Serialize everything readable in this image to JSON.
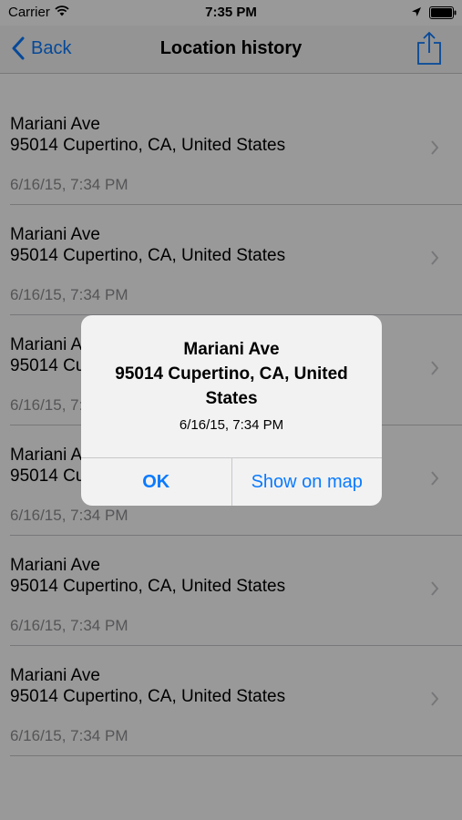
{
  "status_bar": {
    "carrier": "Carrier",
    "time": "7:35 PM",
    "icons": [
      "wifi-icon",
      "location-arrow-icon",
      "battery-icon"
    ]
  },
  "nav": {
    "back_label": "Back",
    "title": "Location history",
    "share_icon": "share-icon"
  },
  "history": [
    {
      "street": "Mariani Ave",
      "city": "95014 Cupertino, CA, United States",
      "date": "6/16/15, 7:34 PM"
    },
    {
      "street": "Mariani Ave",
      "city": "95014 Cupertino, CA, United States",
      "date": "6/16/15, 7:34 PM"
    },
    {
      "street": "Mariani Ave",
      "city": "95014 Cupertino, CA, United States",
      "date": "6/16/15, 7:34 PM"
    },
    {
      "street": "Mariani Ave",
      "city": "95014 Cupertino, CA, United States",
      "date": "6/16/15, 7:34 PM"
    },
    {
      "street": "Mariani Ave",
      "city": "95014 Cupertino, CA, United States",
      "date": "6/16/15, 7:34 PM"
    },
    {
      "street": "Mariani Ave",
      "city": "95014 Cupertino, CA, United States",
      "date": "6/16/15, 7:34 PM"
    }
  ],
  "alert": {
    "title_line1": "Mariani Ave",
    "title_line2": "95014 Cupertino, CA, United",
    "title_line3": "States",
    "message": "6/16/15, 7:34 PM",
    "ok_label": "OK",
    "map_label": "Show on map"
  },
  "colors": {
    "accent": "#0a7aff",
    "separator": "#c8c7cc",
    "secondary_text": "#8e8e93",
    "overlay": "rgba(0,0,0,0.4)"
  }
}
